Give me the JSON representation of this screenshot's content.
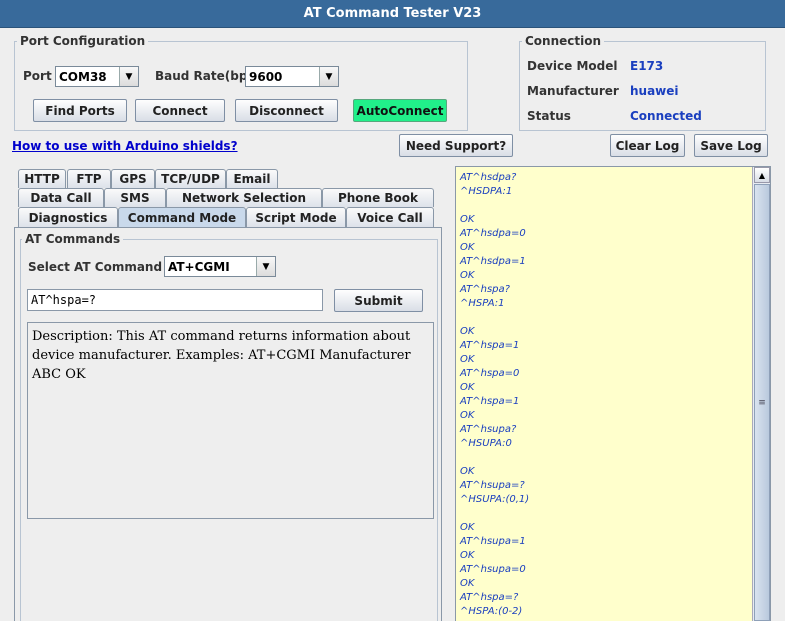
{
  "window": {
    "title": "AT Command Tester V23"
  },
  "port_config": {
    "legend": "Port Configuration",
    "port_label": "Port",
    "port_value": "COM38",
    "baud_label": "Baud Rate(bps)",
    "baud_value": "9600",
    "buttons": {
      "find_ports": "Find Ports",
      "connect": "Connect",
      "disconnect": "Disconnect",
      "autoconnect": "AutoConnect"
    }
  },
  "connection": {
    "legend": "Connection",
    "device_model_label": "Device Model",
    "device_model_value": "E173",
    "manufacturer_label": "Manufacturer",
    "manufacturer_value": "huawei",
    "status_label": "Status",
    "status_value": "Connected"
  },
  "links": {
    "arduino": "How to use with Arduino shields?"
  },
  "toolbar": {
    "need_support": "Need Support?",
    "clear_log": "Clear Log",
    "save_log": "Save Log"
  },
  "tabs": {
    "row1": [
      "HTTP",
      "FTP",
      "GPS",
      "TCP/UDP",
      "Email"
    ],
    "row2": [
      "Data Call",
      "SMS",
      "Network Selection",
      "Phone Book"
    ],
    "row3": [
      "Diagnostics",
      "Command Mode",
      "Script Mode",
      "Voice Call"
    ],
    "active": "Command Mode"
  },
  "at_commands": {
    "legend": "AT Commands",
    "select_label": "Select AT Command",
    "select_value": "AT+CGMI",
    "input_value": "AT^hspa=?",
    "submit": "Submit",
    "description": "Description: This AT command returns information about device manufacturer. Examples: AT+CGMI Manufacturer ABC OK"
  },
  "log": {
    "lines": [
      "AT^hsdpa?",
      "^HSDPA:1",
      "",
      "OK",
      "AT^hsdpa=0",
      "OK",
      "AT^hsdpa=1",
      "OK",
      "AT^hspa?",
      "^HSPA:1",
      "",
      "OK",
      "AT^hspa=1",
      "OK",
      "AT^hspa=0",
      "OK",
      "AT^hspa=1",
      "OK",
      "AT^hsupa?",
      "^HSUPA:0",
      "",
      "OK",
      "AT^hsupa=?",
      "^HSUPA:(0,1)",
      "",
      "OK",
      "AT^hsupa=1",
      "OK",
      "AT^hsupa=0",
      "OK",
      "AT^hspa=?",
      "^HSPA:(0-2)"
    ]
  },
  "colors": {
    "titlebar": "#386a9b",
    "autoconnect": "#21f08a",
    "log_bg": "#ffffcc",
    "value_text": "#1a3fbf"
  }
}
